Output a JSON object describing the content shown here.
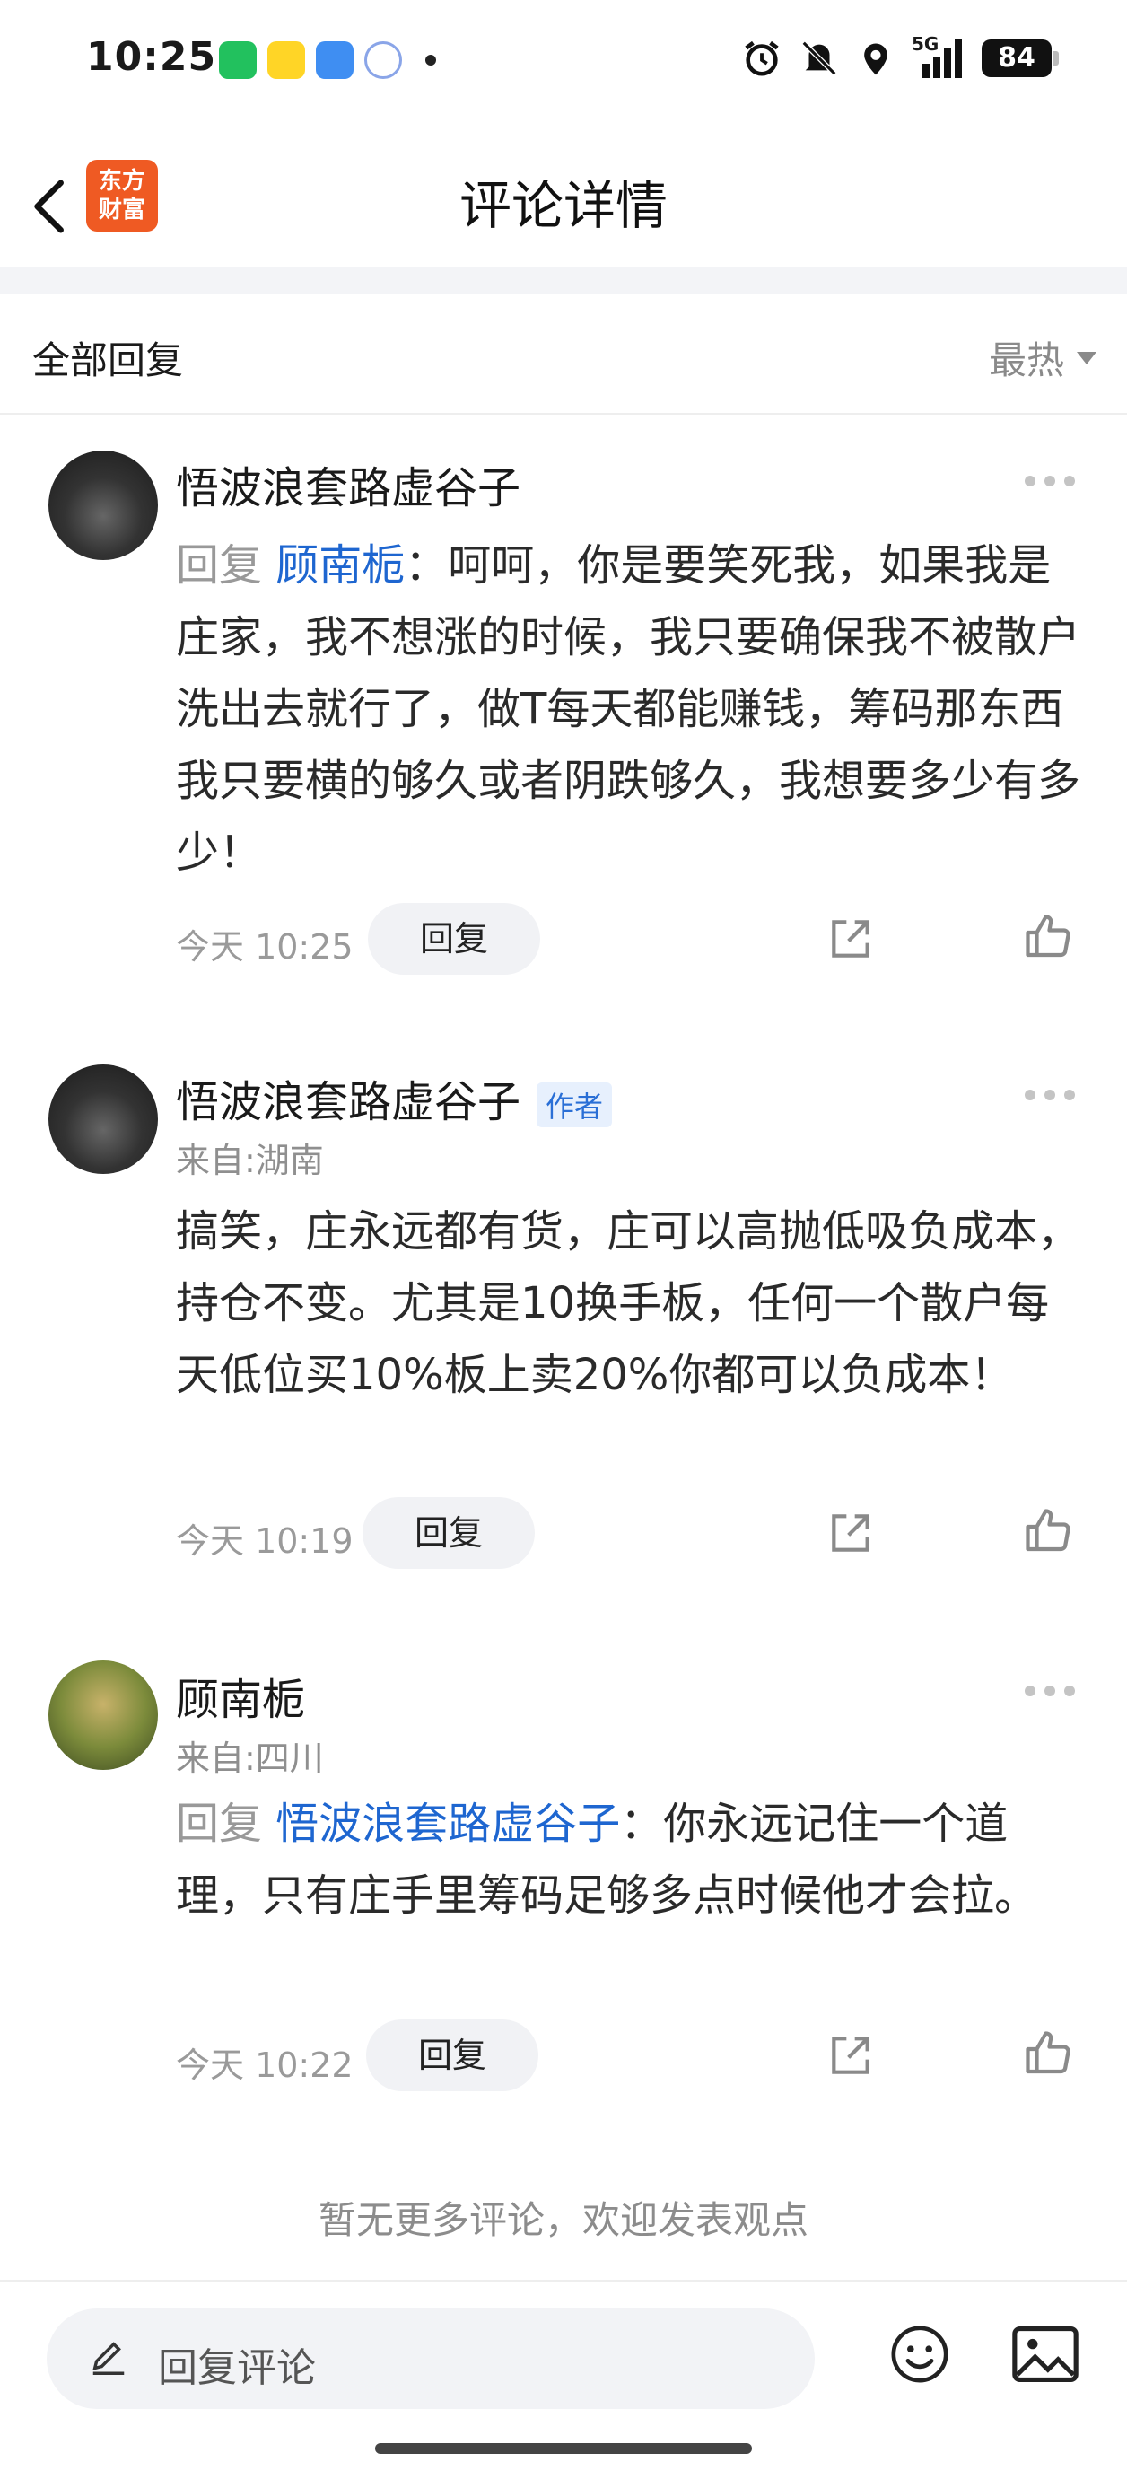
{
  "status": {
    "time": "10:25",
    "network": "5G",
    "battery": "84"
  },
  "nav": {
    "logo_line1": "东方",
    "logo_line2": "财富",
    "title": "评论详情"
  },
  "filter": {
    "title": "全部回复",
    "sort": "最热"
  },
  "comments": [
    {
      "user": "悟波浪套路虚谷子",
      "badge": "",
      "from": "",
      "reply_prefix": "回复 ",
      "reply_target": "顾南栀",
      "text": "：呵呵，你是要笑死我，如果我是庄家，我不想涨的时候，我只要确保我不被散户洗出去就行了，做T每天都能赚钱，筹码那东西我只要横的够久或者阴跌够久，我想要多少有多少！",
      "time": "今天 10:25",
      "reply_label": "回复"
    },
    {
      "user": "悟波浪套路虚谷子",
      "badge": "作者",
      "from": "来自:湖南",
      "reply_prefix": "",
      "reply_target": "",
      "text": "搞笑，庄永远都有货，庄可以高抛低吸负成本，持仓不变。尤其是10换手板，任何一个散户每天低位买10%板上卖20%你都可以负成本！",
      "time": "今天 10:19",
      "reply_label": "回复"
    },
    {
      "user": "顾南栀",
      "badge": "",
      "from": "来自:四川",
      "reply_prefix": "回复 ",
      "reply_target": "悟波浪套路虚谷子",
      "text": "：你永远记住一个道理，只有庄手里筹码足够多点时候他才会拉。",
      "time": "今天 10:22",
      "reply_label": "回复"
    }
  ],
  "footer": {
    "no_more": "暂无更多评论，欢迎发表观点"
  },
  "bottom": {
    "placeholder": "回复评论"
  },
  "icons": [
    "back-arrow-icon",
    "alarm-icon",
    "mute-icon",
    "location-icon",
    "signal-icon",
    "more-icon",
    "share-icon",
    "like-icon",
    "pen-icon",
    "emoji-icon",
    "image-icon"
  ],
  "colors": {
    "accent": "#1e66d0",
    "logo": "#ef5a23"
  }
}
